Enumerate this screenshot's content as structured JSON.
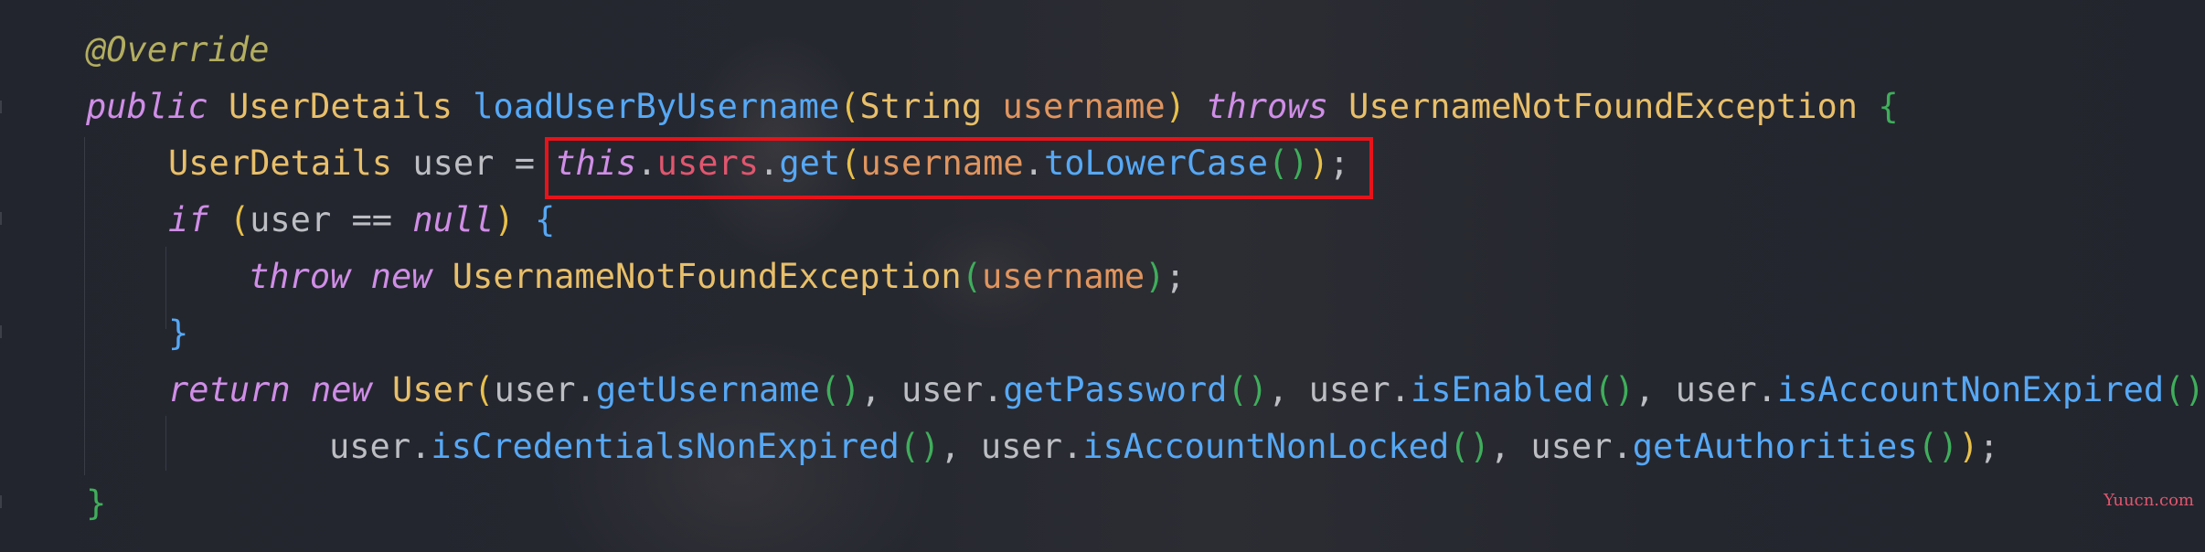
{
  "code": {
    "line1": {
      "annotation": "@Override"
    },
    "line2": {
      "kw_public": "public",
      "type_return": "UserDetails",
      "method_name": "loadUserByUsername",
      "open_paren": "(",
      "param_type": "String",
      "param_name": "username",
      "close_paren": ")",
      "kw_throws": "throws",
      "exception": "UsernameNotFoundException",
      "open_brace": "{"
    },
    "line3": {
      "type": "UserDetails",
      "var": "user",
      "assign": "=",
      "kw_this": "this",
      "dot1": ".",
      "field": "users",
      "dot2": ".",
      "fn_get": "get",
      "p_open": "(",
      "arg": "username",
      "dot3": ".",
      "fn_lower": "toLowerCase",
      "p_inner": "()",
      "p_close": ")",
      "semi": ";"
    },
    "line4": {
      "kw_if": "if",
      "p_open": "(",
      "var": "user",
      "op": "==",
      "kw_null": "null",
      "p_close": ")",
      "brace": "{"
    },
    "line5": {
      "kw_throw": "throw",
      "kw_new": "new",
      "type": "UsernameNotFoundException",
      "p_open": "(",
      "arg": "username",
      "p_close": ")",
      "semi": ";"
    },
    "line6": {
      "brace": "}"
    },
    "line7": {
      "kw_return": "return",
      "kw_new": "new",
      "type": "User",
      "p_open": "(",
      "var1": "user",
      "fn1": "getUsername",
      "var2": "user",
      "fn2": "getPassword",
      "var3": "user",
      "fn3": "isEnabled",
      "var4": "user",
      "fn4": "isAccountNonExpired"
    },
    "line8": {
      "var1": "user",
      "fn1": "isCredentialsNonExpired",
      "var2": "user",
      "fn2": "isAccountNonLocked",
      "var3": "user",
      "fn3": "getAuthorities",
      "p_close": ")",
      "semi": ";"
    },
    "line9": {
      "brace": "}"
    }
  },
  "watermark": "Yuucn.com",
  "colors": {
    "highlight_border": "#e8131a",
    "keyword": "#cf8ee6",
    "type": "#e8bf6a",
    "method": "#56a8f5",
    "parameter": "#e0955f",
    "field": "#e0566e"
  }
}
